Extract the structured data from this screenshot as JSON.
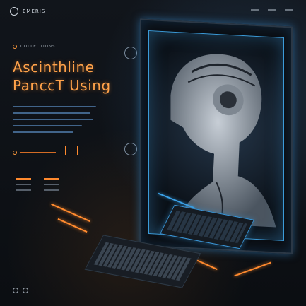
{
  "brand": {
    "name": "EMERIS"
  },
  "section": {
    "tag": "COLLECTIONS"
  },
  "hero": {
    "title_line1": "Ascinthline",
    "title_line2": "PanccT Using"
  },
  "colors": {
    "accent": "#ffa24a",
    "screen_glow": "#3b9bd9",
    "background": "#0d1014"
  },
  "icons": [
    "logo-icon",
    "circle-icon",
    "grid-icon",
    "settings-icon"
  ]
}
